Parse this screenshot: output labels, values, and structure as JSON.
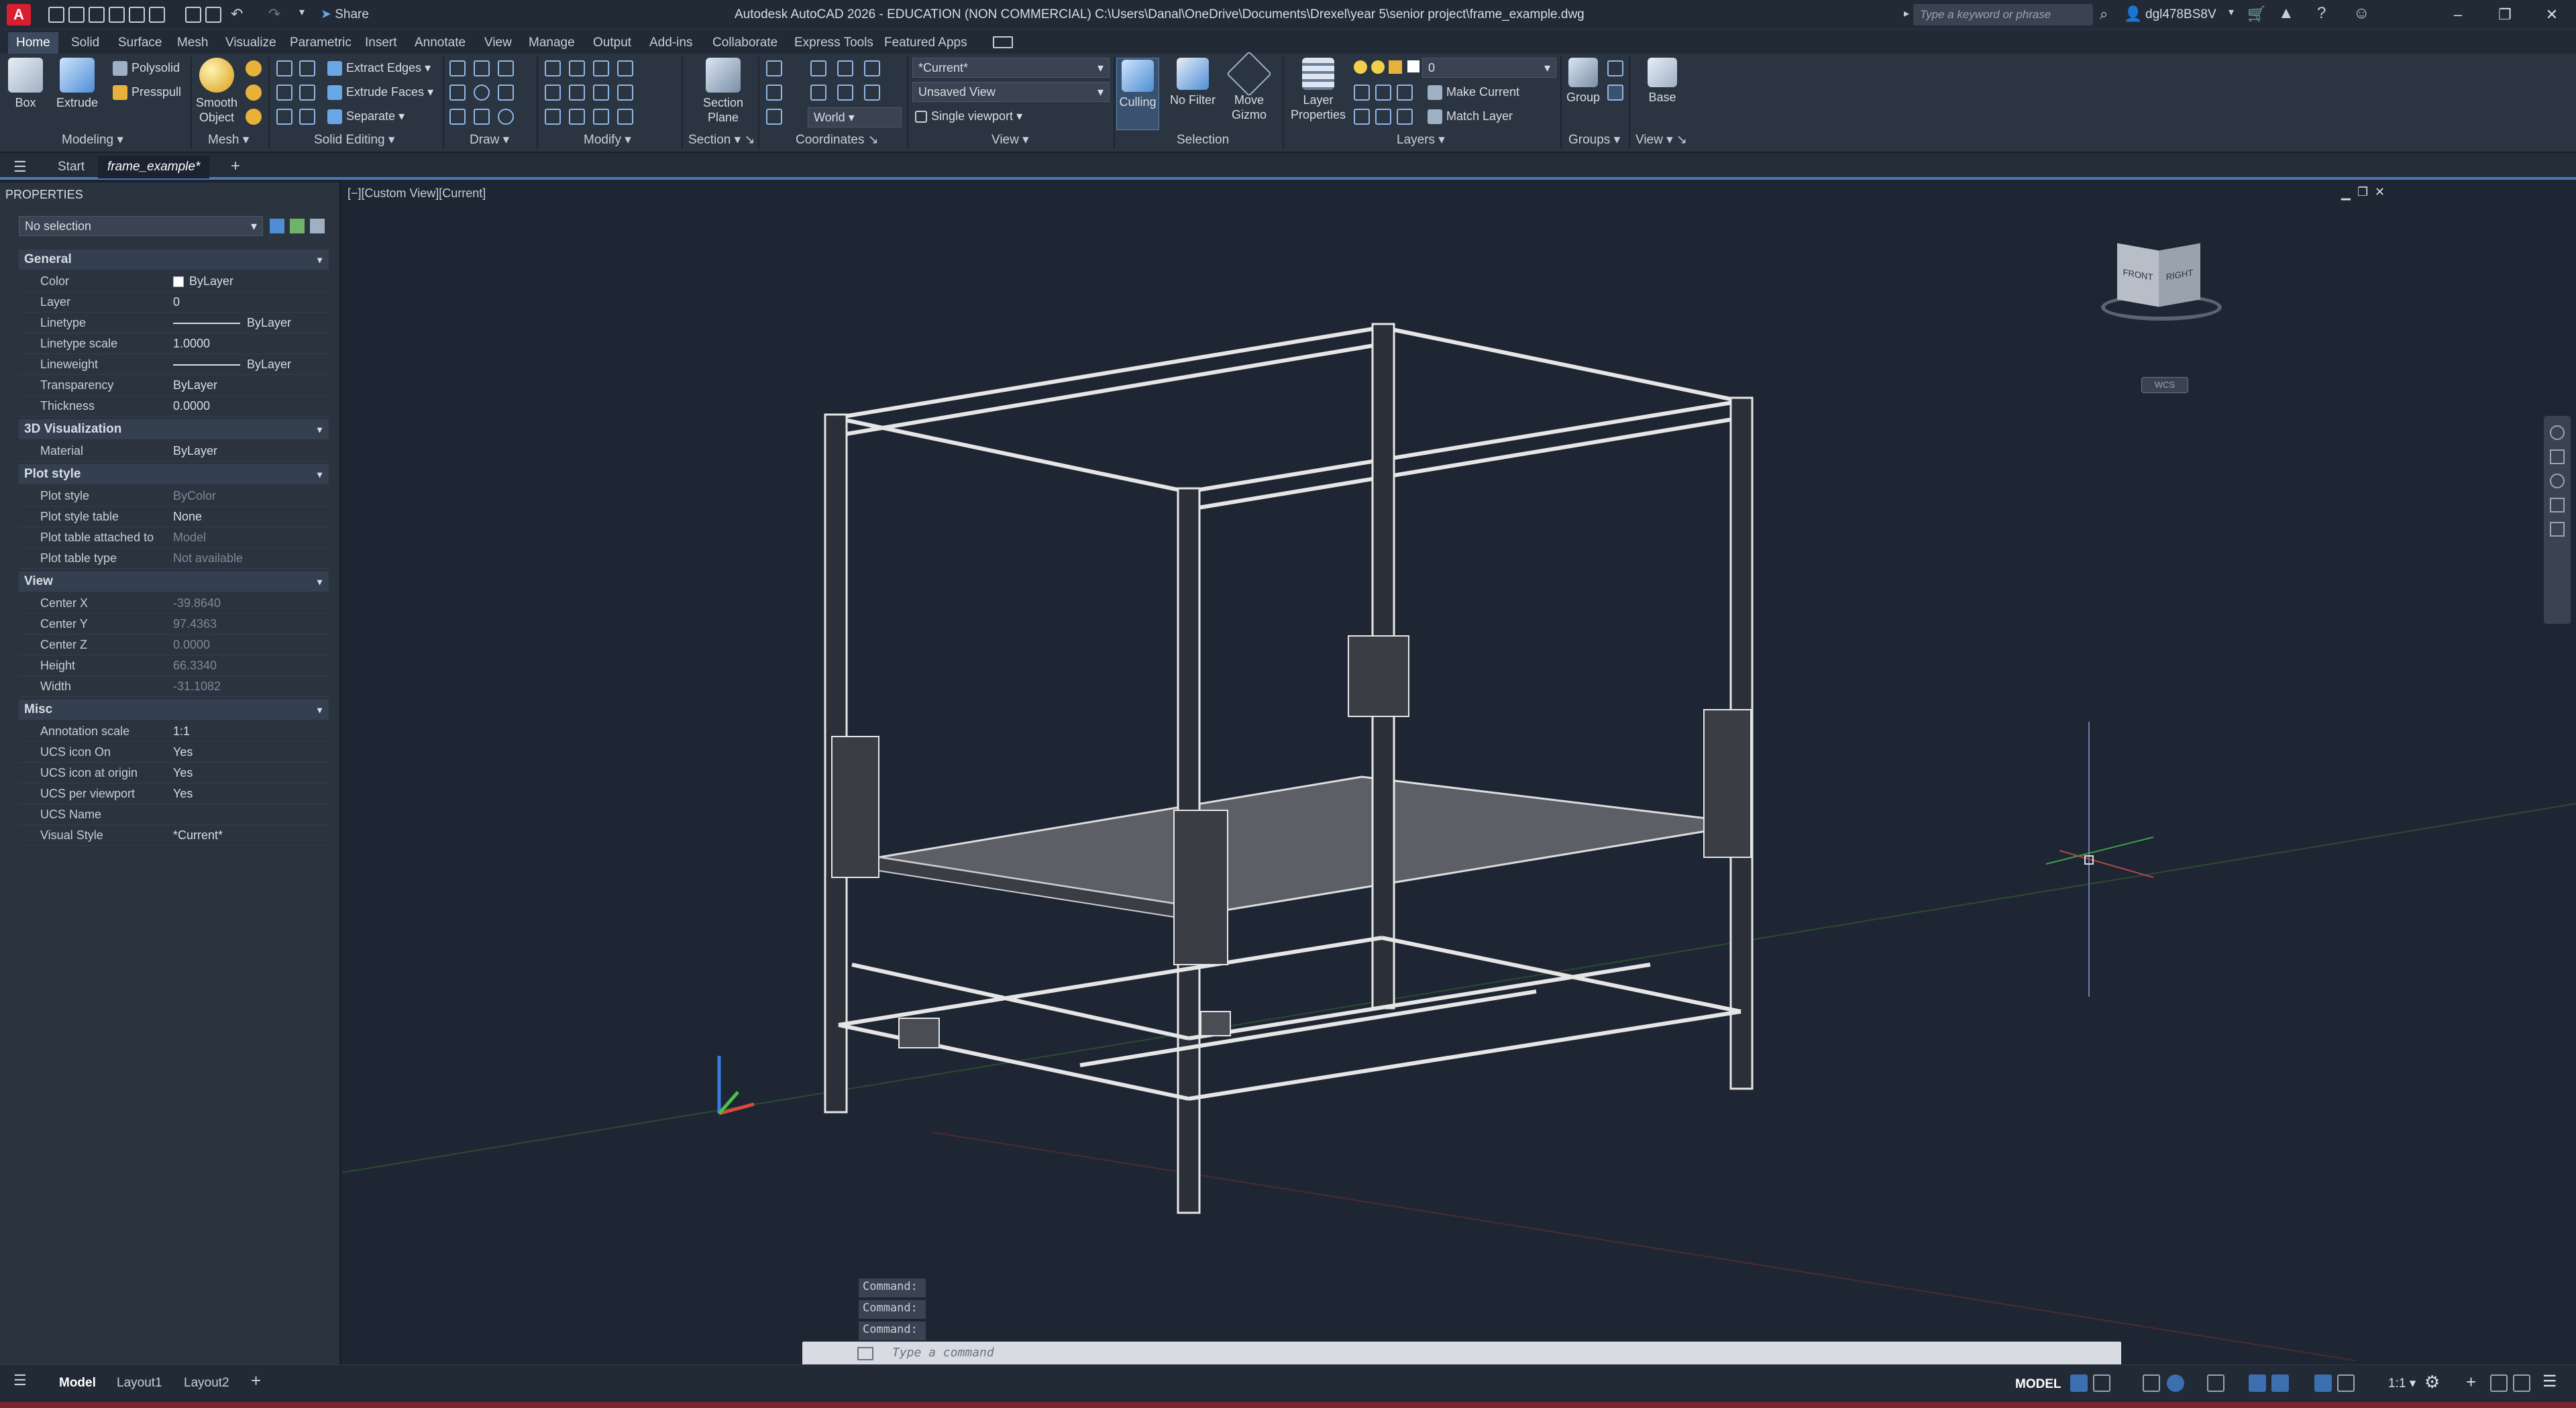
{
  "app": {
    "logo_letter": "A",
    "window_title": "Autodesk AutoCAD 2026 - EDUCATION (NON COMMERCIAL)   C:\\Users\\Danal\\OneDrive\\Documents\\Drexel\\year 5\\senior project\\frame_example.dwg",
    "share_label": "Share",
    "search_placeholder": "Type a keyword or phrase",
    "username": "dgl478BS8V",
    "accent_color": "#d81e2f"
  },
  "ribbon_tabs": [
    "Home",
    "Solid",
    "Surface",
    "Mesh",
    "Visualize",
    "Parametric",
    "Insert",
    "Annotate",
    "View",
    "Manage",
    "Output",
    "Add-ins",
    "Collaborate",
    "Express Tools",
    "Featured Apps"
  ],
  "ribbon": {
    "modeling": {
      "title": "Modeling",
      "box": "Box",
      "extrude": "Extrude",
      "polysolid": "Polysolid",
      "presspull": "Presspull"
    },
    "mesh": {
      "title": "Mesh",
      "smooth_object_1": "Smooth",
      "smooth_object_2": "Object"
    },
    "solid_editing": {
      "title": "Solid Editing",
      "extract_edges": "Extract Edges",
      "extrude_faces": "Extrude Faces",
      "separate": "Separate"
    },
    "draw": {
      "title": "Draw"
    },
    "modify": {
      "title": "Modify"
    },
    "section": {
      "title": "Section",
      "section_plane_1": "Section",
      "section_plane_2": "Plane"
    },
    "coordinates": {
      "title": "Coordinates",
      "world": "World"
    },
    "view": {
      "title": "View",
      "visual_style": "*Current*",
      "named_view": "Unsaved View",
      "viewport": "Single viewport"
    },
    "selection": {
      "title": "Selection",
      "culling": "Culling",
      "no_filter": "No Filter",
      "move_gizmo_1": "Move",
      "move_gizmo_2": "Gizmo"
    },
    "layers": {
      "title": "Layers",
      "layer_properties_1": "Layer",
      "layer_properties_2": "Properties",
      "layer_name": "0",
      "make_current": "Make Current",
      "match_layer": "Match Layer"
    },
    "groups": {
      "title": "Groups",
      "group": "Group"
    },
    "view2": {
      "title": "View",
      "base": "Base"
    }
  },
  "doc_tabs": {
    "start": "Start",
    "active": "frame_example*"
  },
  "properties": {
    "title": "PROPERTIES",
    "selection": "No selection",
    "sections": [
      {
        "name": "General",
        "rows": [
          {
            "k": "Color",
            "v": "ByLayer"
          },
          {
            "k": "Layer",
            "v": "0"
          },
          {
            "k": "Linetype",
            "v": "ByLayer"
          },
          {
            "k": "Linetype scale",
            "v": "1.0000"
          },
          {
            "k": "Lineweight",
            "v": "ByLayer"
          },
          {
            "k": "Transparency",
            "v": "ByLayer"
          },
          {
            "k": "Thickness",
            "v": "0.0000"
          }
        ]
      },
      {
        "name": "3D Visualization",
        "rows": [
          {
            "k": "Material",
            "v": "ByLayer"
          }
        ]
      },
      {
        "name": "Plot style",
        "rows": [
          {
            "k": "Plot style",
            "v": "ByColor"
          },
          {
            "k": "Plot style table",
            "v": "None"
          },
          {
            "k": "Plot table attached to",
            "v": "Model"
          },
          {
            "k": "Plot table type",
            "v": "Not available"
          }
        ]
      },
      {
        "name": "View",
        "rows": [
          {
            "k": "Center X",
            "v": "-39.8640"
          },
          {
            "k": "Center Y",
            "v": "97.4363"
          },
          {
            "k": "Center Z",
            "v": "0.0000"
          },
          {
            "k": "Height",
            "v": "66.3340"
          },
          {
            "k": "Width",
            "v": "-31.1082"
          }
        ]
      },
      {
        "name": "Misc",
        "rows": [
          {
            "k": "Annotation scale",
            "v": "1:1"
          },
          {
            "k": "UCS icon On",
            "v": "Yes"
          },
          {
            "k": "UCS icon at origin",
            "v": "Yes"
          },
          {
            "k": "UCS per viewport",
            "v": "Yes"
          },
          {
            "k": "UCS Name",
            "v": ""
          },
          {
            "k": "Visual Style",
            "v": "*Current*"
          }
        ]
      }
    ]
  },
  "viewport": {
    "label": "[−][Custom View][Current]",
    "viewcube_front": "FRONT",
    "viewcube_right": "RIGHT",
    "wcs": "WCS"
  },
  "command": {
    "history": [
      "Command:",
      "Command:",
      "Command:"
    ],
    "placeholder": "Type a command"
  },
  "status": {
    "model_tab": "Model",
    "layout1": "Layout1",
    "layout2": "Layout2",
    "model_space": "MODEL",
    "scale": "1:1"
  }
}
